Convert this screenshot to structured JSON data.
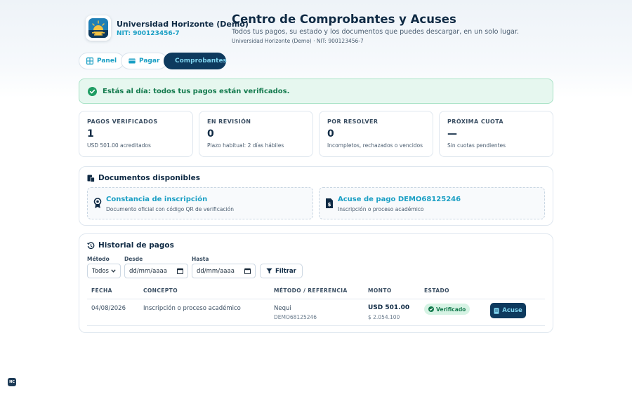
{
  "org": {
    "name": "Universidad Horizonte (Demo)",
    "nit": "NIT: 900123456-7"
  },
  "page": {
    "title": "Centro de Comprobantes y Acuses",
    "subtitle": "Todos tus pagos, su estado y los documentos que puedes descargar, en un solo lugar.",
    "org_line": "Universidad Horizonte (Demo) · NIT: 900123456-7"
  },
  "tabs": [
    {
      "label": "Panel",
      "icon": "grid-icon"
    },
    {
      "label": "Pagar",
      "icon": "card-icon"
    },
    {
      "label": "Comprobantes",
      "icon": "document-icon",
      "active": true
    }
  ],
  "alert": {
    "text": "Estás al día: todos tus pagos están verificados."
  },
  "stats": [
    {
      "label": "PAGOS VERIFICADOS",
      "value": "1",
      "note": "USD 501.00 acreditados"
    },
    {
      "label": "EN REVISIÓN",
      "value": "0",
      "note": "Plazo habitual: 2 días hábiles"
    },
    {
      "label": "POR RESOLVER",
      "value": "0",
      "note": "Incompletos, rechazados o vencidos"
    },
    {
      "label": "PRÓXIMA CUOTA",
      "value": "—",
      "note": "Sin cuotas pendientes"
    }
  ],
  "documents": {
    "title": "Documentos disponibles",
    "items": [
      {
        "title": "Constancia de inscripción",
        "sub": "Documento oficial con código QR de verificación",
        "icon": "award-icon"
      },
      {
        "title": "Acuse de pago DEMO68125246",
        "sub": "Inscripción o proceso académico",
        "icon": "receipt-icon"
      }
    ]
  },
  "history": {
    "title": "Historial de pagos",
    "filters": {
      "method_label": "Método",
      "method_value": "Todos",
      "from_label": "Desde",
      "from_value": "dd/mm/aaaa",
      "to_label": "Hasta",
      "to_value": "dd/mm/aaaa",
      "filter_button": "Filtrar"
    },
    "columns": [
      "FECHA",
      "CONCEPTO",
      "MÉTODO / REFERENCIA",
      "MONTO",
      "ESTADO"
    ],
    "rows": [
      {
        "date": "04/08/2026",
        "concept": "Inscripción o proceso académico",
        "method": "Nequi",
        "reference": "DEMO68125246",
        "amount": "USD 501.00",
        "amount_local": "$ 2.054.100",
        "status": "Verificado",
        "action": "Acuse"
      }
    ]
  },
  "corner_badge": "NC",
  "colors": {
    "navy": "#0e3a5e",
    "accent": "#1a9fc4",
    "success": "#137a4d",
    "success_bg": "#e6f7ef"
  }
}
